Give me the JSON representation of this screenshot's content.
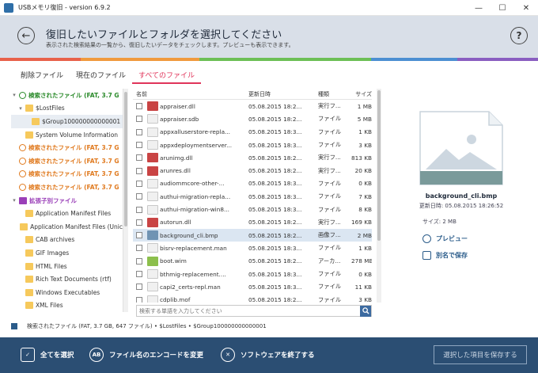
{
  "window": {
    "title": "USBメモリ復旧 - version 6.9.2",
    "minimize": "—",
    "maximize": "☐",
    "close": "✕"
  },
  "header": {
    "title": "復旧したいファイルとフォルダを選択してください",
    "subtitle": "表示された検索結果の一覧から、復旧したいデータをチェックします。プレビューも表示できます。",
    "back_icon": "←",
    "help_icon": "?"
  },
  "progress_colors": [
    "#e8614a",
    "#f09a3e",
    "#6dbf56",
    "#4c8fd2",
    "#8a5ec0"
  ],
  "tabs": [
    {
      "label": "削除ファイル"
    },
    {
      "label": "現在のファイル"
    },
    {
      "label": "すべてのファイル"
    }
  ],
  "tree": [
    {
      "label": "検索されたファイル (FAT, 3.7 G",
      "style": "green",
      "icon": "drive",
      "indent": 0,
      "exp": "▾"
    },
    {
      "label": "$LostFiles",
      "style": "",
      "icon": "folder",
      "indent": 1,
      "exp": "▾"
    },
    {
      "label": "$Group100000000000001",
      "style": "",
      "icon": "folder",
      "indent": 2,
      "exp": "",
      "selected": true
    },
    {
      "label": "System Volume Information",
      "style": "",
      "icon": "folder",
      "indent": 1,
      "exp": ""
    },
    {
      "label": "検索されたファイル (FAT, 3.7 G",
      "style": "orange",
      "icon": "drive-orange",
      "indent": 0,
      "exp": ""
    },
    {
      "label": "検索されたファイル (FAT, 3.7 G",
      "style": "orange",
      "icon": "drive-orange",
      "indent": 0,
      "exp": ""
    },
    {
      "label": "検索されたファイル (FAT, 3.7 G",
      "style": "orange",
      "icon": "drive-orange",
      "indent": 0,
      "exp": ""
    },
    {
      "label": "検索されたファイル (FAT, 3.7 G",
      "style": "orange",
      "icon": "drive-orange",
      "indent": 0,
      "exp": ""
    },
    {
      "label": "拡張子別ファイル",
      "style": "purple",
      "icon": "purple",
      "indent": 0,
      "exp": "▾"
    },
    {
      "label": "Application Manifest Files",
      "style": "",
      "icon": "folder",
      "indent": 1,
      "exp": ""
    },
    {
      "label": "Application Manifest Files (Unic",
      "style": "",
      "icon": "folder",
      "indent": 1,
      "exp": ""
    },
    {
      "label": "CAB archives",
      "style": "",
      "icon": "folder",
      "indent": 1,
      "exp": ""
    },
    {
      "label": "GIF Images",
      "style": "",
      "icon": "folder",
      "indent": 1,
      "exp": ""
    },
    {
      "label": "HTML Files",
      "style": "",
      "icon": "folder",
      "indent": 1,
      "exp": ""
    },
    {
      "label": "Rich Text Documents (rtf)",
      "style": "",
      "icon": "folder",
      "indent": 1,
      "exp": ""
    },
    {
      "label": "Windows Executables",
      "style": "",
      "icon": "folder",
      "indent": 1,
      "exp": ""
    },
    {
      "label": "XML Files",
      "style": "",
      "icon": "folder",
      "indent": 1,
      "exp": ""
    }
  ],
  "filelist": {
    "headers": {
      "name": "名前",
      "date": "更新日時",
      "type": "種類",
      "size": "サイズ"
    },
    "rows": [
      {
        "name": "appraiser.dll",
        "date": "05.08.2015 18:2...",
        "type": "実行フ...",
        "size": "1 MB",
        "icon": "dll"
      },
      {
        "name": "appraiser.sdb",
        "date": "05.08.2015 18:2...",
        "type": "ファイル",
        "size": "5 MB",
        "icon": "doc"
      },
      {
        "name": "appxalluserstore-repla...",
        "date": "05.08.2015 18:3...",
        "type": "ファイル",
        "size": "1 KB",
        "icon": "doc"
      },
      {
        "name": "appxdeploymentserver...",
        "date": "05.08.2015 18:3...",
        "type": "ファイル",
        "size": "3 KB",
        "icon": "doc"
      },
      {
        "name": "arunimg.dll",
        "date": "05.08.2015 18:2...",
        "type": "実行フ...",
        "size": "813 KB",
        "icon": "dll"
      },
      {
        "name": "arunres.dll",
        "date": "05.08.2015 18:2...",
        "type": "実行フ...",
        "size": "20 KB",
        "icon": "dll"
      },
      {
        "name": "audiommcore-other-...",
        "date": "05.08.2015 18:3...",
        "type": "ファイル",
        "size": "0 KB",
        "icon": "doc"
      },
      {
        "name": "authui-migration-repla...",
        "date": "05.08.2015 18:3...",
        "type": "ファイル",
        "size": "7 KB",
        "icon": "doc"
      },
      {
        "name": "authui-migration-win8...",
        "date": "05.08.2015 18:3...",
        "type": "ファイル",
        "size": "8 KB",
        "icon": "doc"
      },
      {
        "name": "autorun.dll",
        "date": "05.08.2015 18:2...",
        "type": "実行フ...",
        "size": "169 KB",
        "icon": "dll"
      },
      {
        "name": "background_cli.bmp",
        "date": "05.08.2015 18:2...",
        "type": "画像フ...",
        "size": "2 MB",
        "icon": "img",
        "highlight": true
      },
      {
        "name": "bisrv-replacement.man",
        "date": "05.08.2015 18:3...",
        "type": "ファイル",
        "size": "1 KB",
        "icon": "doc"
      },
      {
        "name": "boot.wim",
        "date": "05.08.2015 18:2...",
        "type": "アーカ...",
        "size": "278 MB",
        "icon": "arc"
      },
      {
        "name": "bthmig-replacement....",
        "date": "05.08.2015 18:3...",
        "type": "ファイル",
        "size": "0 KB",
        "icon": "doc"
      },
      {
        "name": "capi2_certs-repl.man",
        "date": "05.08.2015 18:3...",
        "type": "ファイル",
        "size": "11 KB",
        "icon": "doc"
      },
      {
        "name": "cdplib.mof",
        "date": "05.08.2015 18:2...",
        "type": "ファイル",
        "size": "3 KB",
        "icon": "doc"
      }
    ]
  },
  "search": {
    "placeholder": "検索する単語を入力してください",
    "icon": "search-icon"
  },
  "preview": {
    "name": "background_cli.bmp",
    "date": "更新日時: 05.08.2015 18:26:52",
    "size": "サイズ: 2 MB",
    "preview_label": "プレビュー",
    "save_as_label": "別名で保存"
  },
  "statusbar": {
    "path": "検索されたファイル (FAT, 3.7 GB, 647 ファイル)  • $LostFiles  • $Group100000000000001"
  },
  "footer": {
    "select_all": "全てを選択",
    "encode": "ファイル名のエンコードを変更",
    "exit": "ソフトウェアを終了する",
    "save_selected": "選択した項目を保存する",
    "encode_icon_text": "AB"
  }
}
